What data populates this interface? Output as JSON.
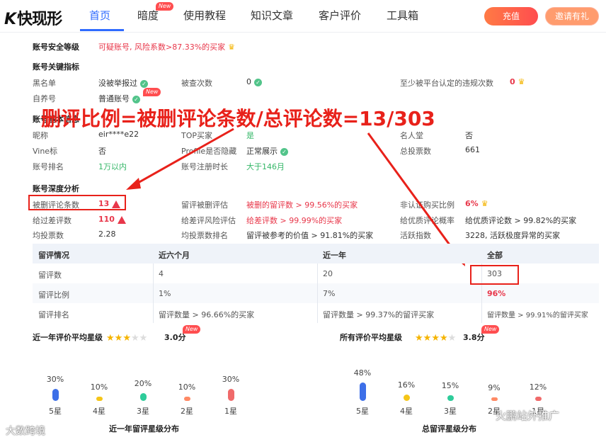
{
  "nav": {
    "logo": "快现形",
    "items": [
      {
        "label": "首页",
        "new": false
      },
      {
        "label": "暗度",
        "new": true
      },
      {
        "label": "使用教程",
        "new": false
      },
      {
        "label": "知识文章",
        "new": false
      },
      {
        "label": "客户评价",
        "new": false
      },
      {
        "label": "工具箱",
        "new": false
      }
    ],
    "new_tag": "New",
    "recharge": "充值",
    "invite": "邀请有礼"
  },
  "security": {
    "label": "账号安全等级",
    "value": "可疑账号, 风险系数>87.33%的买家"
  },
  "key_metrics": {
    "title": "账号关键指标",
    "blacklist_label": "黑名单",
    "blacklist_value": "没被举报过",
    "checked_label": "被查次数",
    "checked_value": "0",
    "violations_label": "至少被平台认定的违规次数",
    "violations_value": "0",
    "self_label": "自养号",
    "self_value": "普通账号",
    "self_new": "New"
  },
  "basic": {
    "title": "账号基本信息",
    "nickname_label": "昵称",
    "nickname_value": "eir****e22",
    "top_label": "TOP买家",
    "top_value": "是",
    "fame_label": "名人堂",
    "fame_value": "否",
    "vine_label": "Vine标",
    "vine_value": "否",
    "profile_label": "Profile是否隐藏",
    "profile_value": "正常展示",
    "votes_label": "总投票数",
    "votes_value": "661",
    "rank_label": "账号排名",
    "rank_value": "1万以内",
    "age_label": "账号注册时长",
    "age_value": "大于146月"
  },
  "deep": {
    "title": "账号深度分析",
    "deleted_label": "被删评论条数",
    "deleted_value": "13",
    "kept_label": "留评被删评估",
    "kept_value": "被删的留评数 > 99.56%的买家",
    "nonverified_label": "非认证购买比例",
    "nonverified_value": "6%",
    "bad_label": "给过差评数",
    "bad_value": "110",
    "bad_risk_label": "给差评风险评估",
    "bad_risk_value": "给差评数 > 99.99%的买家",
    "good_label": "给优质评论概率",
    "good_value": "给优质评论数 > 99.82%的买家",
    "avgvote_label": "均投票数",
    "avgvote_value": "2.28",
    "avgrank_label": "均投票数排名",
    "avgrank_value": "留评被参考的价值 > 91.81%的买家",
    "active_label": "活跃指数",
    "active_value": "3228, 活跃极度异常的买家"
  },
  "annotation": "删评比例=被删评论条数/总评论数=13/303",
  "table": {
    "headers": [
      "留评情况",
      "近六个月",
      "近一年",
      "全部"
    ],
    "rows": [
      [
        "留评数",
        "4",
        "20",
        "303"
      ],
      [
        "留评比例",
        "1%",
        "7%",
        "96%"
      ],
      [
        "留评排名",
        "留评数量 > 96.66%的买家",
        "留评数量 > 99.37%的留评买家",
        "留评数量 > 99.91%的留评买家"
      ]
    ]
  },
  "year_rating": {
    "title": "近一年评价平均星级",
    "score": "3.0分",
    "stars_on": 3,
    "new": "New",
    "dist_title": "近一年留评星级分布",
    "dist": [
      {
        "label": "5星",
        "pct": "30%",
        "value": 30,
        "color": "#3d6fe8"
      },
      {
        "label": "4星",
        "pct": "10%",
        "value": 10,
        "color": "#f5c518"
      },
      {
        "label": "3星",
        "pct": "20%",
        "value": 20,
        "color": "#2ecc9a"
      },
      {
        "label": "2星",
        "pct": "10%",
        "value": 10,
        "color": "#ff8a65"
      },
      {
        "label": "1星",
        "pct": "30%",
        "value": 30,
        "color": "#f06a6a"
      }
    ]
  },
  "all_rating": {
    "title": "所有评价平均星级",
    "score": "3.8分",
    "stars_on": 4,
    "new": "New",
    "dist_title": "总留评星级分布",
    "dist": [
      {
        "label": "5星",
        "pct": "48%",
        "value": 48,
        "color": "#3d6fe8"
      },
      {
        "label": "4星",
        "pct": "16%",
        "value": 16,
        "color": "#f5c518"
      },
      {
        "label": "3星",
        "pct": "15%",
        "value": 15,
        "color": "#2ecc9a"
      },
      {
        "label": "2星",
        "pct": "9%",
        "value": 9,
        "color": "#ff8a65"
      },
      {
        "label": "1星",
        "pct": "12%",
        "value": 12,
        "color": "#f06a6a"
      }
    ]
  },
  "watermark_left": "大数跨境",
  "watermark_right": "火鹏站外推广"
}
